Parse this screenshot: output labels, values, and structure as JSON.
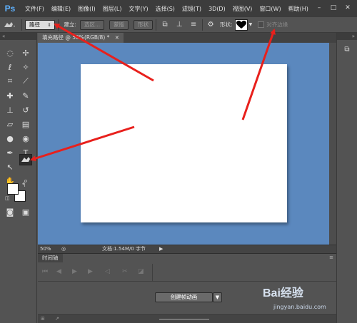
{
  "app": {
    "logo": "Ps"
  },
  "menu": [
    "文件(F)",
    "编辑(E)",
    "图像(I)",
    "图层(L)",
    "文字(Y)",
    "选择(S)",
    "滤镜(T)",
    "3D(D)",
    "视图(V)",
    "窗口(W)",
    "帮助(H)"
  ],
  "window_controls": {
    "minimize": "–",
    "maximize": "□",
    "close": "✕"
  },
  "options": {
    "mode_value": "路径",
    "make_label": "建立:",
    "selection_button": "选区...",
    "mask_button": "蒙版",
    "shape_button": "形状",
    "shape_label": "形状:",
    "align_edges_label": "对齐边缘"
  },
  "document": {
    "tab_title": "填充路径 @ 50%(RGB/8) *",
    "tab_close": "×"
  },
  "status": {
    "zoom": "50%",
    "doc_info": "文档:1.54M/0 字节"
  },
  "timeline": {
    "tab_label": "时间轴",
    "create_button": "创建帧动画"
  },
  "watermark": {
    "logo_text": "Bai经验",
    "url": "jingyan.baidu.com"
  },
  "colors": {
    "canvas_bg": "#5b88be",
    "arrow": "#e8201c"
  }
}
